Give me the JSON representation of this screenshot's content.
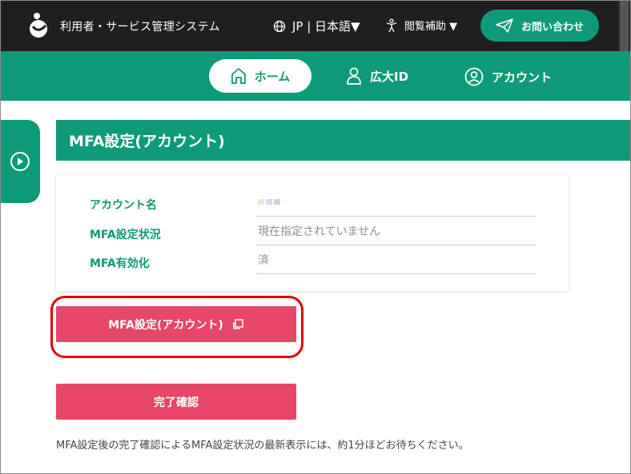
{
  "topbar": {
    "system_title": "利用者・サービス管理システム",
    "lang_label": "JP | 日本語▼",
    "accessibility_label": "閲覧補助 ▼",
    "contact_label": "お問い合わせ"
  },
  "nav": {
    "home_label": "ホーム",
    "id_label": "広大ID",
    "account_label": "アカウント"
  },
  "page": {
    "title": "MFA設定(アカウント)"
  },
  "fields": [
    {
      "label": "アカウント名",
      "value": ""
    },
    {
      "label": "MFA設定状況",
      "value": "現在指定されていません"
    },
    {
      "label": "MFA有効化",
      "value": "済"
    }
  ],
  "buttons": {
    "mfa_setup_label": "MFA設定(アカウント)",
    "complete_label": "完了確認"
  },
  "note": "MFA設定後の完了確認によるMFA設定状況の最新表示には、約1分ほどお待ちください。",
  "colors": {
    "brand_green": "#0e9a78",
    "topbar": "#1f1f1f",
    "button_pink": "#e64667",
    "highlight_red": "#e00000"
  }
}
